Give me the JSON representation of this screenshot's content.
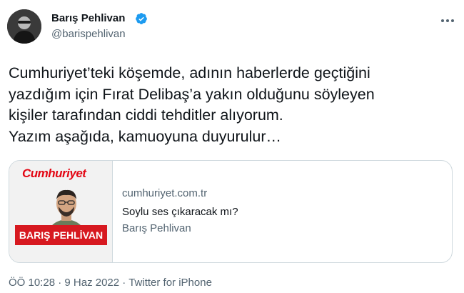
{
  "author": {
    "name": "Barış Pehlivan",
    "handle": "@barispehlivan"
  },
  "icons": {
    "avatar": "author-avatar",
    "verified": "verified-badge-icon",
    "more": "more-options-icon"
  },
  "colors": {
    "verified": "#1d9bf0",
    "brand_red": "#d71920",
    "secondary_text": "#536471"
  },
  "tweet": {
    "lines": [
      "Cumhuriyet’teki köşemde, adının haberlerde geçtiğini",
      "yazdığım için Fırat Delibaş’a yakın olduğunu söyleyen",
      "kişiler tarafından ciddi tehditler alıyorum.",
      "Yazım aşağıda, kamuoyuna duyurulur…"
    ]
  },
  "card": {
    "thumb_brand": "Cumhuriyet",
    "thumb_banner": "BARIŞ PEHLİVAN",
    "domain": "cumhuriyet.com.tr",
    "title": "Soylu ses çıkaracak mı?",
    "description": "Barış Pehlivan"
  },
  "meta": {
    "time": "ÖÖ 10:28",
    "separator": " · ",
    "date": "9 Haz 2022",
    "source": "Twitter for iPhone"
  }
}
